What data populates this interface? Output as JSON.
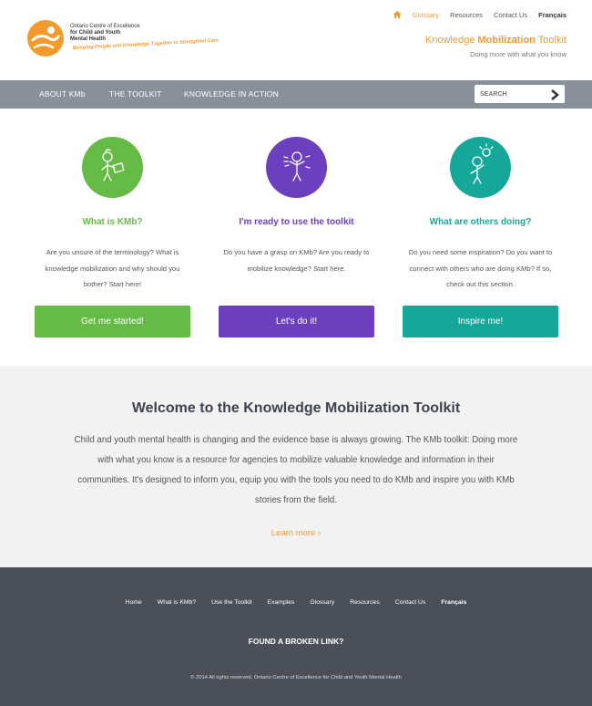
{
  "logo": {
    "line1": "Ontario Centre of Excellence",
    "line2": "for Child and Youth",
    "line3": "Mental Health",
    "tagline": "Bringing People and Knowledge Together to Strengthen Care"
  },
  "topnav": {
    "glossary": "Glossary",
    "resources": "Resources",
    "contact": "Contact Us",
    "french": "Français"
  },
  "brand": {
    "pre": "Knowledge ",
    "bold": "Mobilization",
    "post": " Toolkit",
    "sub": "Doing more with what you know"
  },
  "mainnav": {
    "about": "ABOUT KMb",
    "toolkit": "THE TOOLKIT",
    "action": "KNOWLEDGE IN ACTION",
    "search_placeholder": "SEARCH"
  },
  "cards": [
    {
      "title": "What is KMb?",
      "text": "Are you unsure of the terminology? What is knowledge mobilization and why should you bother? Start here!",
      "button": "Get me started!",
      "color": "#66bb46"
    },
    {
      "title": "I'm ready to use the toolkit",
      "text": "Do you have a grasp on KMb? Are you ready to mobilize knowledge? Start here.",
      "button": "Let's do it!",
      "color": "#6c3fbf"
    },
    {
      "title": "What are others doing?",
      "text": "Do you need some inspiration? Do you want to connect with others who are doing KMb? If so, check out this section.",
      "button": "Inspire me!",
      "color": "#15a89a"
    }
  ],
  "welcome": {
    "title": "Welcome to the Knowledge Mobilization Toolkit",
    "text": "Child and youth mental health is changing and the evidence base is always growing. The KMb toolkit: Doing more with what you know is a resource for agencies to mobilize valuable knowledge and information in their communities. It's designed to inform you, equip you with the tools you need to do KMb and inspire you with KMb stories from the field.",
    "more": "Learn more ›"
  },
  "footer": {
    "links": [
      "Home",
      "What is KMb?",
      "Use the Toolkit",
      "Examples",
      "Glossary",
      "Resources",
      "Contact Us",
      "Français"
    ],
    "broken": "FOUND A BROKEN LINK?",
    "copyright": "© 2014 All rights reserved, Ontario Centre of Excellence for Child and Youth Mental Health"
  },
  "colors": {
    "accent": "#f39a2d",
    "nav_bg": "#8a909a",
    "footer_bg": "#4b4f58"
  }
}
